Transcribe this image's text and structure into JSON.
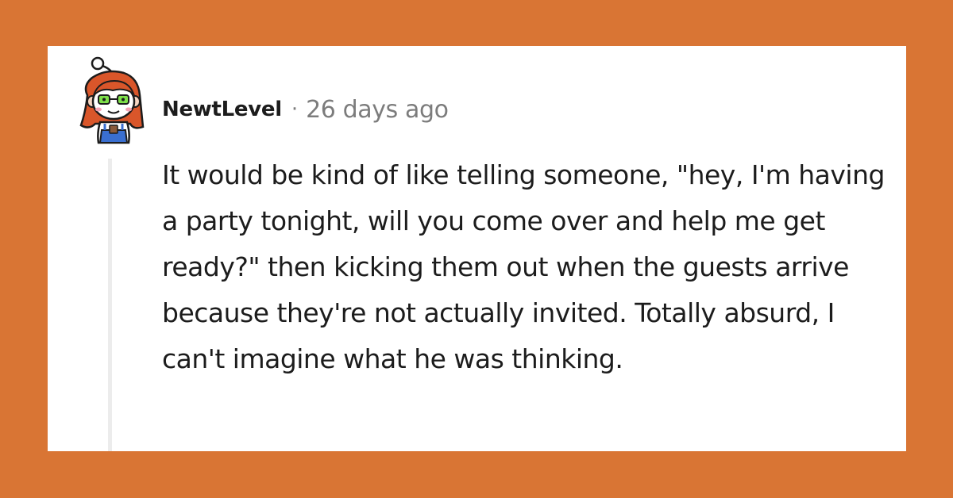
{
  "comment": {
    "author": "NewtLevel",
    "separator": "·",
    "timestamp": "26 days ago",
    "body": "It would be kind of like telling someone, \"hey, I'm having a party tonight, will you come over and help me get ready?\" then kicking them out when the guests arrive because they're not actually invited. Totally absurd, I can't imagine what he was thinking."
  },
  "avatar": {
    "icon": "snoo-avatar-icon",
    "description_colors": {
      "hair": "#d9562a",
      "glasses": "#7ee04a",
      "overalls": "#3a6fd0"
    }
  },
  "colors": {
    "background": "#d97534",
    "card": "#ffffff",
    "text": "#1c1c1c",
    "meta": "#7c7c7c",
    "thread_line": "#ececec"
  }
}
